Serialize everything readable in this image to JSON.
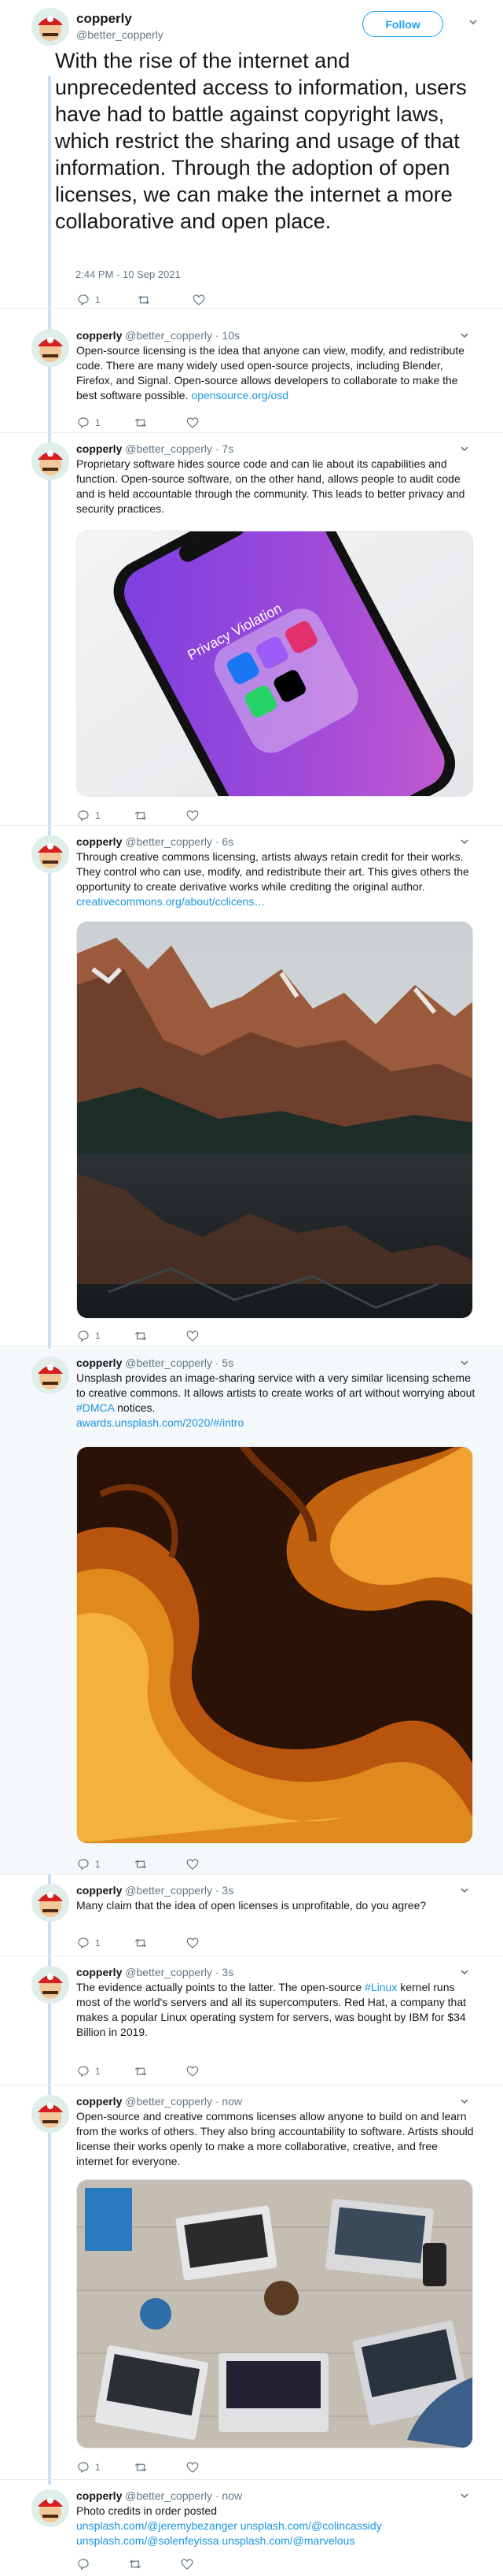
{
  "main": {
    "name": "copperly",
    "handle": "@better_copperly",
    "follow_label": "Follow",
    "text": "With the rise of the internet and unprecedented access to information, users have had to battle against copyright laws, which restrict the sharing and usage of that information. Through the adoption of open licenses, we can make the internet a more collaborative and open place.",
    "timestamp": "2:44 PM - 10 Sep 2021",
    "reply_count": "1"
  },
  "replies": [
    {
      "name": "copperly",
      "handle": "@better_copperly",
      "sep": " · ",
      "time": "10s",
      "text": "Open-source licensing is the idea that anyone can view, modify, and redistribute code. There are many widely used open-source projects, including Blender, Firefox, and Signal. Open-source allows developers to collaborate to make the best software possible.",
      "link": "opensource.org/osd",
      "reply_count": "1"
    },
    {
      "name": "copperly",
      "handle": "@better_copperly",
      "sep": " · ",
      "time": "7s",
      "text": "Proprietary software hides source code and can lie about its capabilities and function. Open-source software, on the other hand, allows people to audit code and is held accountable through the community. This leads to better privacy and security practices.",
      "media_caption": "Privacy Violation",
      "reply_count": "1"
    },
    {
      "name": "copperly",
      "handle": "@better_copperly",
      "sep": " · ",
      "time": "6s",
      "text": "Through creative commons licensing, artists always retain credit for their works. They control who can use, modify, and redistribute their art. This gives others the opportunity to create derivative works while crediting the original author.",
      "link": "creativecommons.org/about/cclicens…",
      "reply_count": "1"
    },
    {
      "name": "copperly",
      "handle": "@better_copperly",
      "sep": " · ",
      "time": "5s",
      "text_before": "Unsplash provides an image-sharing service with a very similar licensing scheme to creative commons. It allows artists to create works of art without worrying about ",
      "hashtag": "#DMCA",
      "text_after": " notices.",
      "link": "awards.unsplash.com/2020/#/intro",
      "reply_count": "1"
    },
    {
      "name": "copperly",
      "handle": "@better_copperly",
      "sep": " · ",
      "time": "3s",
      "text": "Many claim that the idea of open licenses is unprofitable, do you agree?",
      "reply_count": "1"
    },
    {
      "name": "copperly",
      "handle": "@better_copperly",
      "sep": " · ",
      "time": "3s",
      "text_before": "The evidence actually points to the latter. The open-source ",
      "hashtag": "#Linux",
      "text_after": " kernel runs most of the world's servers and all its supercomputers. Red Hat, a company that makes a popular Linux operating system for servers, was bought by IBM for $34 Billion in 2019.",
      "reply_count": "1"
    },
    {
      "name": "copperly",
      "handle": "@better_copperly",
      "sep": " · ",
      "time": "now",
      "text": "Open-source and creative commons licenses allow anyone to build on and learn from the works of others. They also bring accountability to software. Artists should license their works openly to make a more collaborative, creative, and free internet for everyone.",
      "reply_count": "1"
    },
    {
      "name": "copperly",
      "handle": "@better_copperly",
      "sep": " · ",
      "time": "now",
      "text": "Photo credits in order posted",
      "links": "unsplash.com/@jeremybezanger unsplash.com/@colincassidy unsplash.com/@solenfeyissa unsplash.com/@marvelous",
      "reply_count": "0"
    }
  ],
  "colors": {
    "accent": "#1da1f2",
    "link": "#1b95e0",
    "muted": "#657786",
    "thread": "#c9e0f5"
  }
}
